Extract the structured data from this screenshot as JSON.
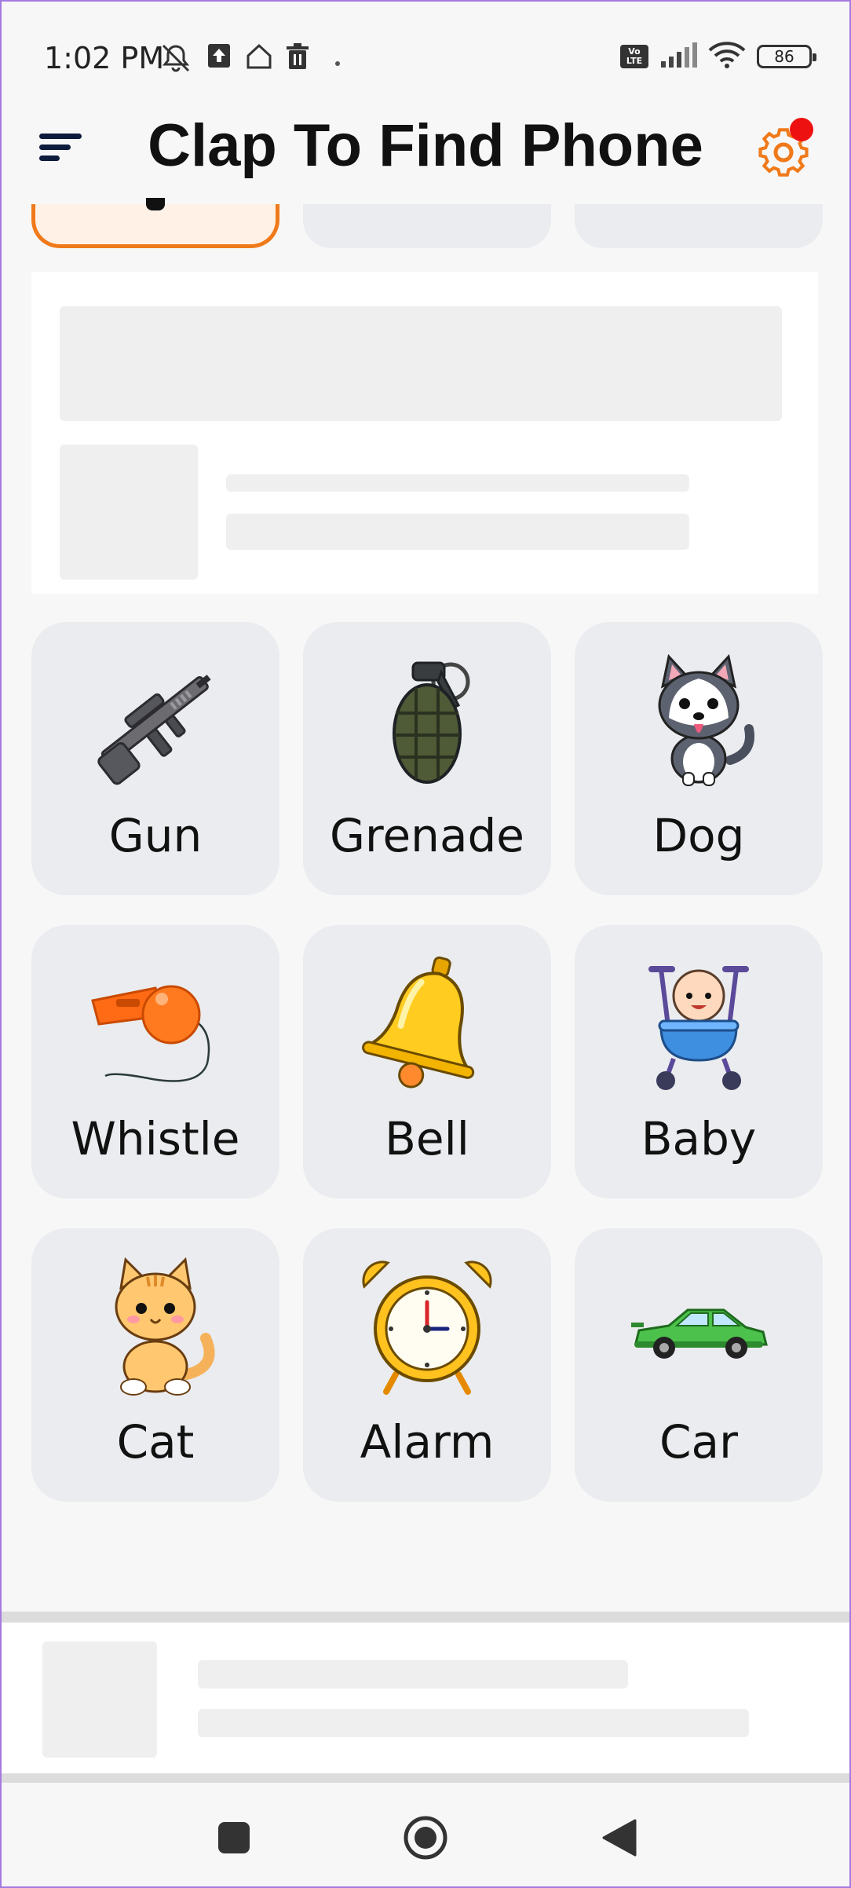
{
  "status_bar": {
    "time": "1:02 PM",
    "volte": "Vo LTE",
    "battery": "86",
    "icons": [
      "mute-icon",
      "upload-icon",
      "home-icon",
      "trash-icon",
      "dot-icon",
      "signal-icon",
      "wifi-icon",
      "battery-icon"
    ]
  },
  "header": {
    "title": "Clap To Find Phone",
    "menu_icon": "menu-icon",
    "settings_icon": "gear-icon",
    "accent_color": "#f07a1a",
    "notification_color": "#ee1111"
  },
  "sounds": [
    {
      "label": "Gun",
      "icon": "gun-icon"
    },
    {
      "label": "Grenade",
      "icon": "grenade-icon"
    },
    {
      "label": "Dog",
      "icon": "dog-icon"
    },
    {
      "label": "Whistle",
      "icon": "whistle-icon"
    },
    {
      "label": "Bell",
      "icon": "bell-icon"
    },
    {
      "label": "Baby",
      "icon": "baby-icon"
    },
    {
      "label": "Cat",
      "icon": "cat-icon"
    },
    {
      "label": "Alarm",
      "icon": "alarm-clock-icon"
    },
    {
      "label": "Car",
      "icon": "car-icon"
    }
  ],
  "nav": {
    "recents": "square-icon",
    "home": "circle-icon",
    "back": "triangle-back-icon"
  }
}
